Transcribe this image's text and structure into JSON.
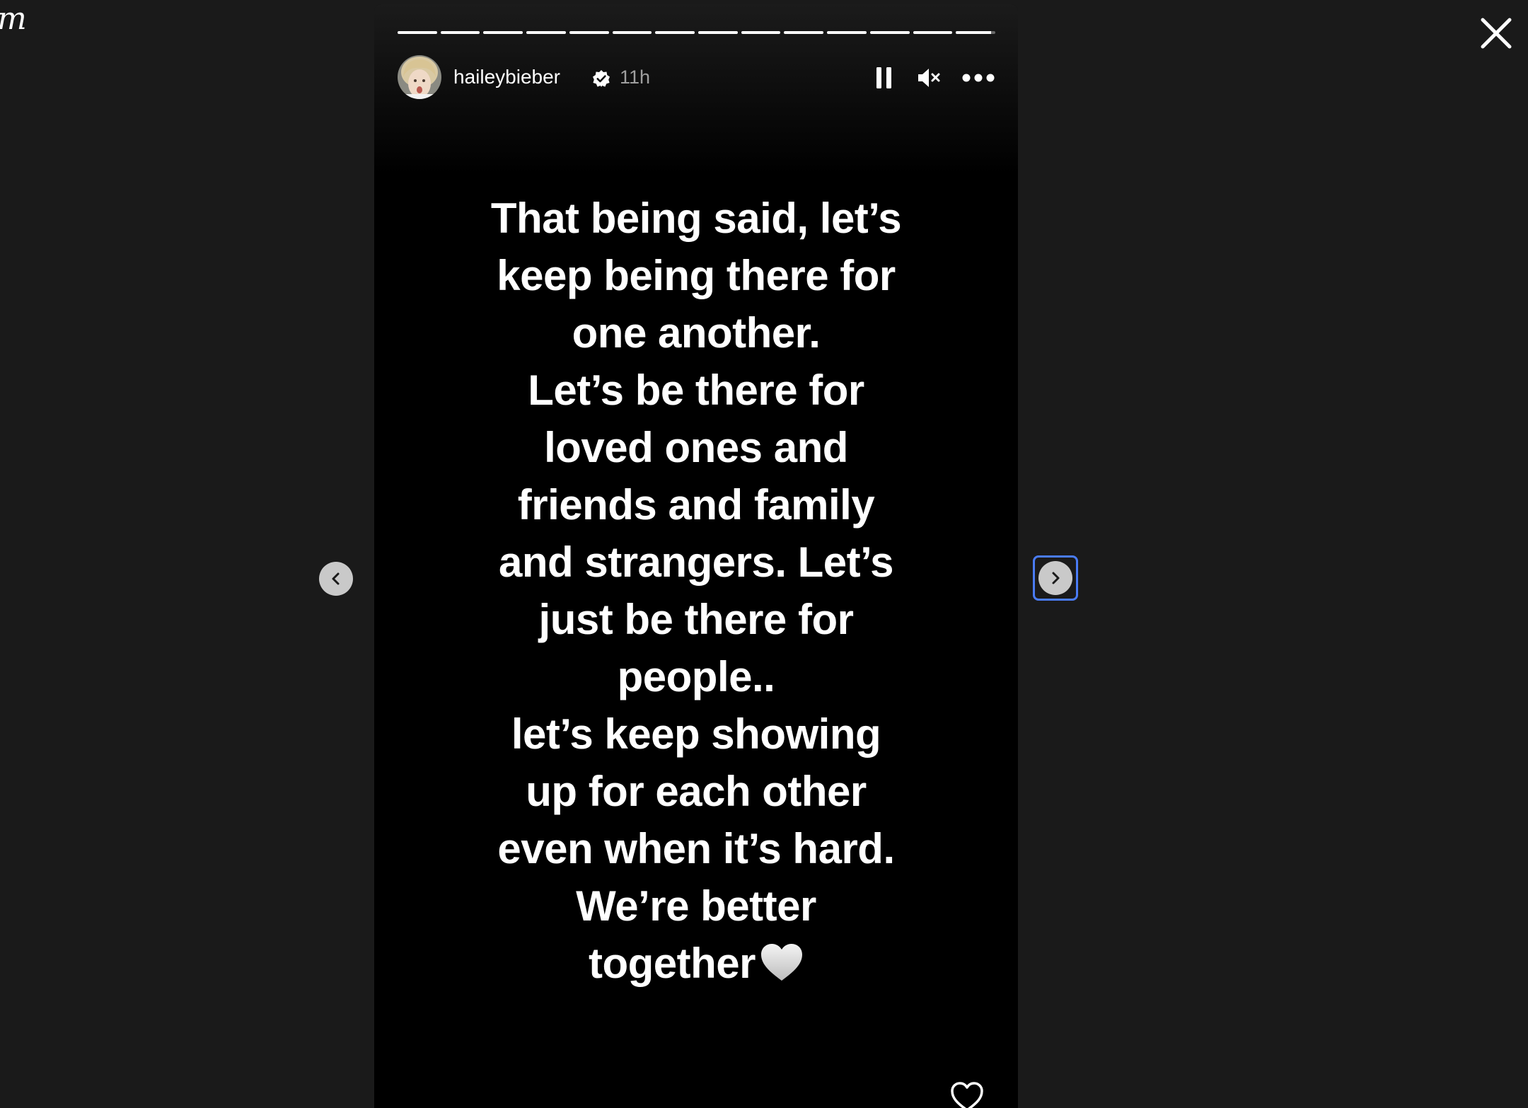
{
  "brand": {
    "fragment": "m"
  },
  "story": {
    "progress_segments": 14,
    "progress_completed": 13,
    "current_segment_fraction": 0.9,
    "author": {
      "username": "haileybieber",
      "verified": true,
      "timestamp": "11h",
      "avatar": "avatar-photo"
    },
    "controls": {
      "pause": "pause-icon",
      "mute": "speaker-muted-icon",
      "more": "more-options-icon"
    },
    "text_lines": [
      "That being said, let’s",
      "keep being there for",
      "one another.",
      "Let’s be there for",
      "loved ones and",
      "friends and family",
      "and strangers. Let’s",
      "just be there for",
      "people..",
      "let’s keep showing",
      "up for each other",
      "even when it’s hard.",
      "We’re better",
      "together"
    ],
    "trailing_emoji": "white-heart-emoji",
    "like_icon": "heart-outline-icon"
  },
  "navigation": {
    "prev_icon": "chevron-left-icon",
    "next_icon": "chevron-right-icon",
    "close_icon": "close-icon"
  },
  "colors": {
    "page_background": "#1a1a1a",
    "story_background": "#000000",
    "focus_ring": "#4a7cf6",
    "nav_button": "#c9c9c9",
    "text": "#ffffff"
  }
}
